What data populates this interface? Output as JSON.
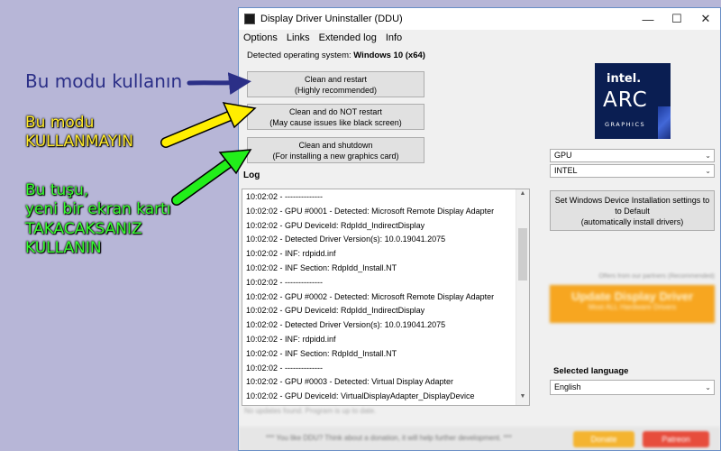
{
  "annotations": {
    "blue": "Bu modu kullanın",
    "yellow": [
      "Bu modu",
      "KULLANMAYIN"
    ],
    "green": [
      "Bu tuşu,",
      "yeni bir ekran kartı",
      "TAKACAKSANIZ",
      "KULLANIN"
    ]
  },
  "colors": {
    "blue_arrow": "#2b2f87",
    "yellow_arrow": "#ffee00",
    "green_arrow": "#22ee1a",
    "window_accent": "#6a8fc6",
    "update_button": "#f7a620"
  },
  "window": {
    "title": "Display Driver Uninstaller (DDU)",
    "controls": {
      "minimize": "—",
      "maximize": "☐",
      "close": "✕"
    },
    "menu": [
      "Options",
      "Links",
      "Extended log",
      "Info"
    ],
    "detected_label": "Detected operating system:",
    "detected_os": "Windows 10 (x64)",
    "buttons": {
      "clean_restart": [
        "Clean and restart",
        "(Highly recommended)"
      ],
      "clean_no_restart": [
        "Clean and do NOT restart",
        "(May cause issues like black screen)"
      ],
      "clean_shutdown": [
        "Clean and shutdown",
        "(For installing a new graphics card)"
      ]
    },
    "logo": {
      "brand": "intel.",
      "product": "ARC",
      "tagline": "GRAPHICS"
    },
    "device_type": "GPU",
    "vendor": "INTEL",
    "set_windows_button": [
      "Set Windows Device Installation settings to",
      "to Default",
      "(automatically install drivers)"
    ],
    "log_label": "Log",
    "log_lines": [
      "10:02:02 - --------------",
      "10:02:02 - GPU #0001 - Detected: Microsoft Remote Display Adapter",
      "10:02:02 - GPU DeviceId: RdpIdd_IndirectDisplay",
      "10:02:02 - Detected Driver Version(s): 10.0.19041.2075",
      "10:02:02 - INF: rdpidd.inf",
      "10:02:02 - INF Section: RdpIdd_Install.NT",
      "10:02:02 - --------------",
      "10:02:02 - GPU #0002 - Detected: Microsoft Remote Display Adapter",
      "10:02:02 - GPU DeviceId: RdpIdd_IndirectDisplay",
      "10:02:02 - Detected Driver Version(s): 10.0.19041.2075",
      "10:02:02 - INF: rdpidd.inf",
      "10:02:02 - INF Section: RdpIdd_Install.NT",
      "10:02:02 - --------------",
      "10:02:02 - GPU #0003 - Detected: Virtual Display Adapter",
      "10:02:02 - GPU DeviceId: VirtualDisplayAdapter_DisplayDevice"
    ],
    "sponsor_note": "Offers from our partners (Recommended)",
    "update_button": [
      "Update Display Driver",
      "Most ALL Hardware Drivers"
    ],
    "language_label": "Selected language",
    "language": "English",
    "status_text": "No updates found. Program is up to date.",
    "footer_text": "*** You like DDU? Think about a donation, it will help further development. ***",
    "donate_label": "Donate",
    "patreon_label": "Patreon"
  }
}
